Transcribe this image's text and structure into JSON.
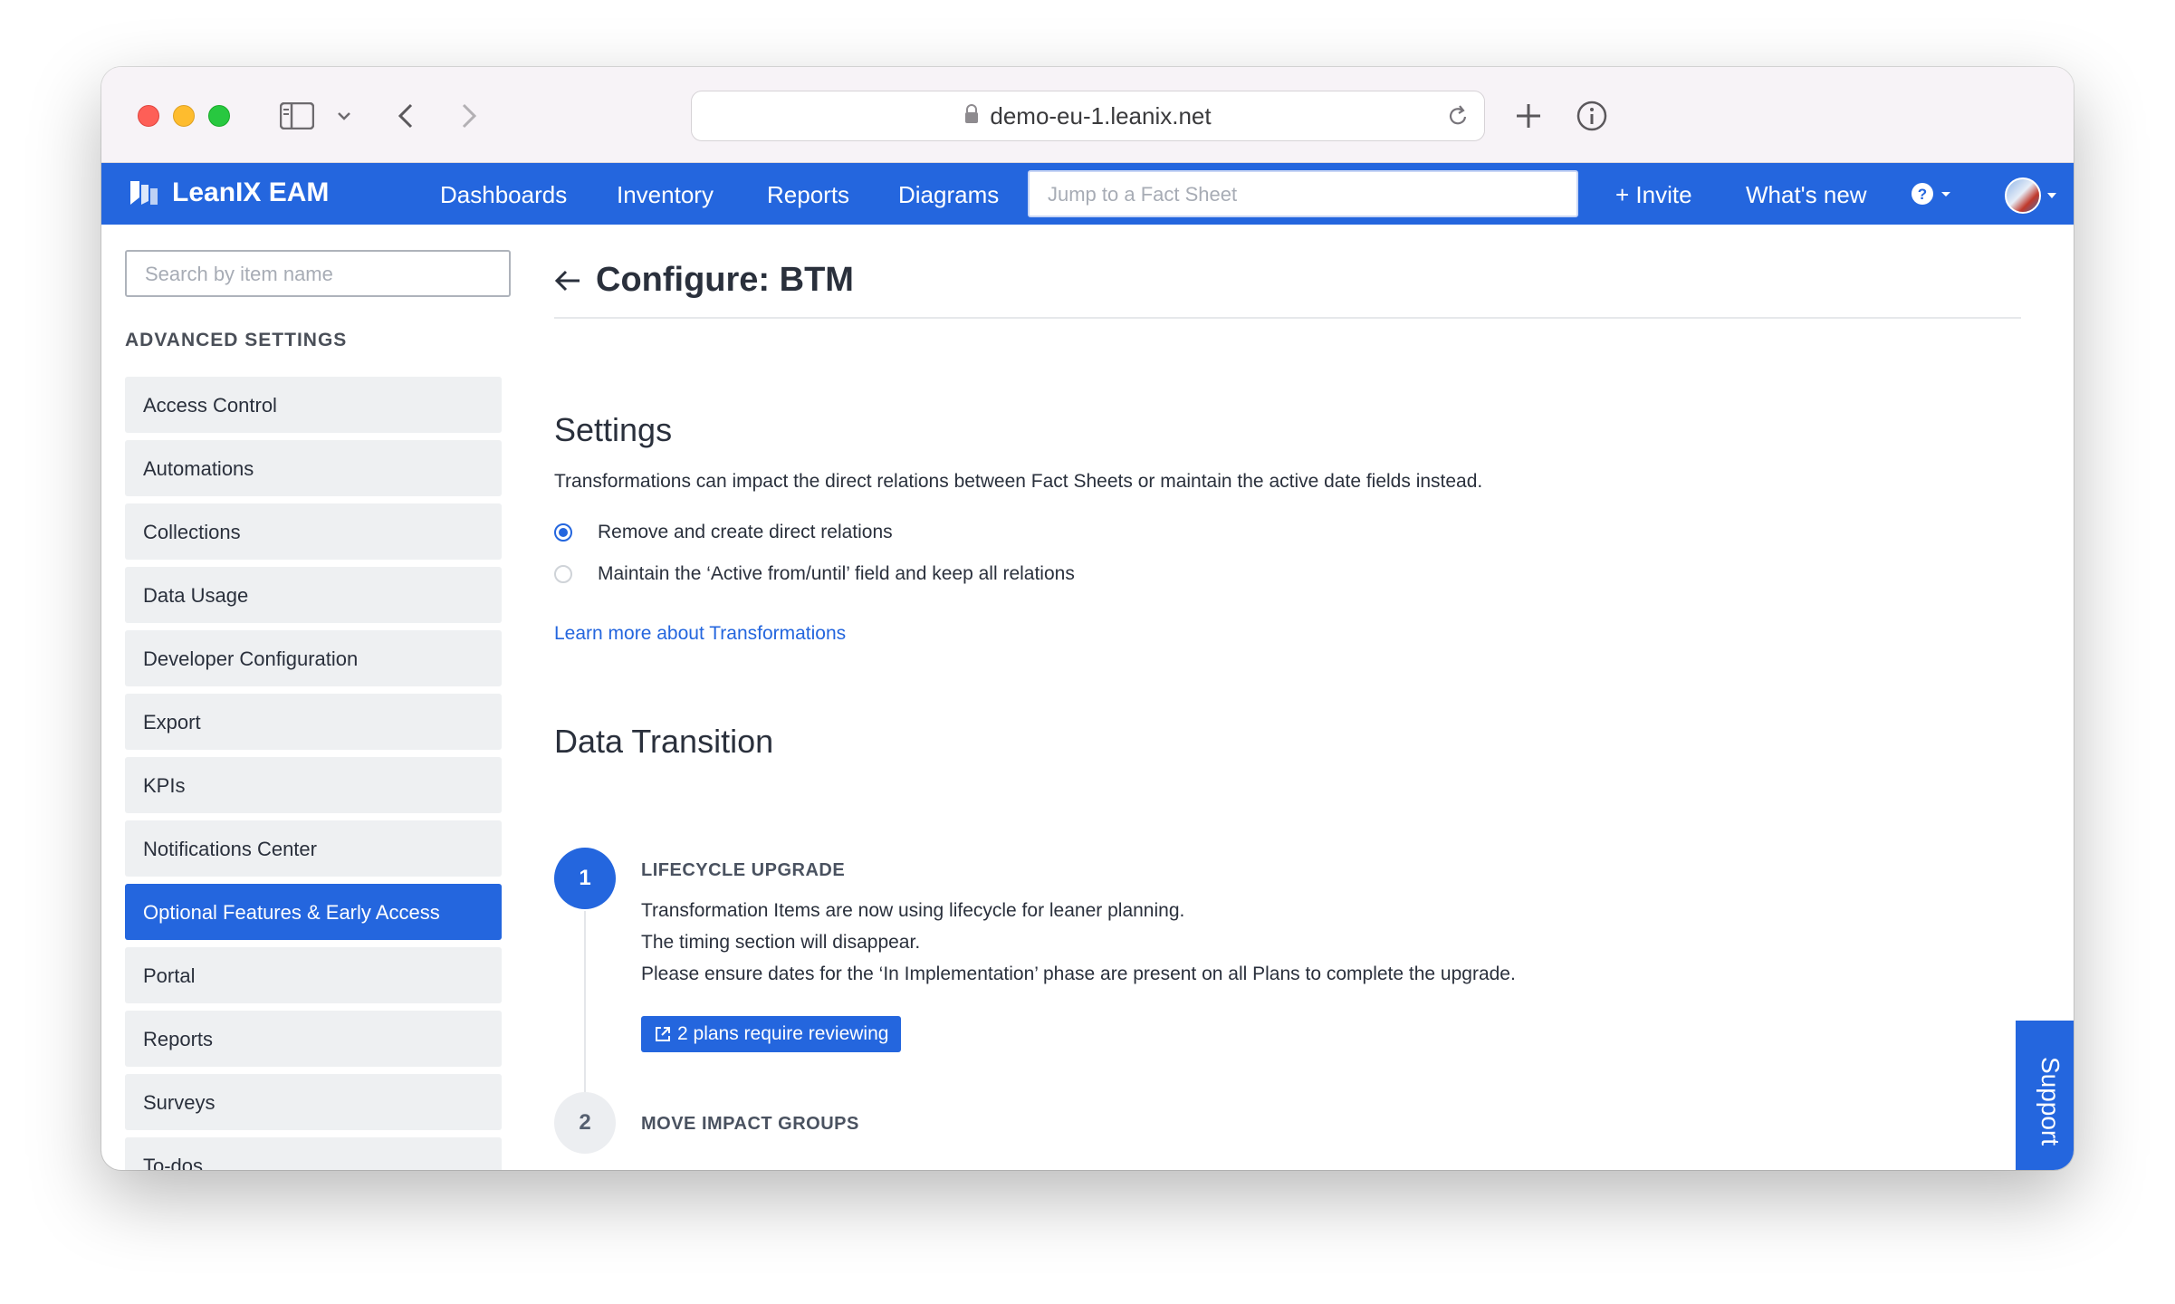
{
  "browser": {
    "url": "demo-eu-1.leanix.net"
  },
  "app": {
    "brand": "LeanIX EAM",
    "nav": [
      "Dashboards",
      "Inventory",
      "Reports",
      "Diagrams"
    ],
    "jump_placeholder": "Jump to a Fact Sheet",
    "invite": "+ Invite",
    "whats_new": "What's new"
  },
  "sidebar": {
    "search_placeholder": "Search by item name",
    "heading": "ADVANCED SETTINGS",
    "items": [
      {
        "label": "Access Control"
      },
      {
        "label": "Automations"
      },
      {
        "label": "Collections"
      },
      {
        "label": "Data Usage"
      },
      {
        "label": "Developer Configuration"
      },
      {
        "label": "Export"
      },
      {
        "label": "KPIs"
      },
      {
        "label": "Notifications Center"
      },
      {
        "label": "Optional Features & Early Access",
        "active": true
      },
      {
        "label": "Portal"
      },
      {
        "label": "Reports"
      },
      {
        "label": "Surveys"
      },
      {
        "label": "To-dos"
      }
    ]
  },
  "main": {
    "title": "Configure: BTM",
    "settings": {
      "heading": "Settings",
      "description": "Transformations can impact the direct relations between Fact Sheets or maintain the active date fields instead.",
      "options": [
        {
          "label": "Remove and create direct relations",
          "selected": true
        },
        {
          "label": "Maintain the ‘Active from/until’ field and keep all relations",
          "selected": false
        }
      ],
      "learn_more": "Learn more about Transformations"
    },
    "transition": {
      "heading": "Data Transition",
      "steps": [
        {
          "number": "1",
          "title": "LIFECYCLE UPGRADE",
          "lines": [
            "Transformation Items are now using lifecycle for leaner planning.",
            "The timing section will disappear.",
            "Please ensure dates for the ‘In Implementation’ phase are present on all Plans to complete the upgrade."
          ],
          "button": "2 plans require reviewing"
        },
        {
          "number": "2",
          "title": "MOVE IMPACT GROUPS"
        }
      ]
    }
  },
  "support": "Support"
}
